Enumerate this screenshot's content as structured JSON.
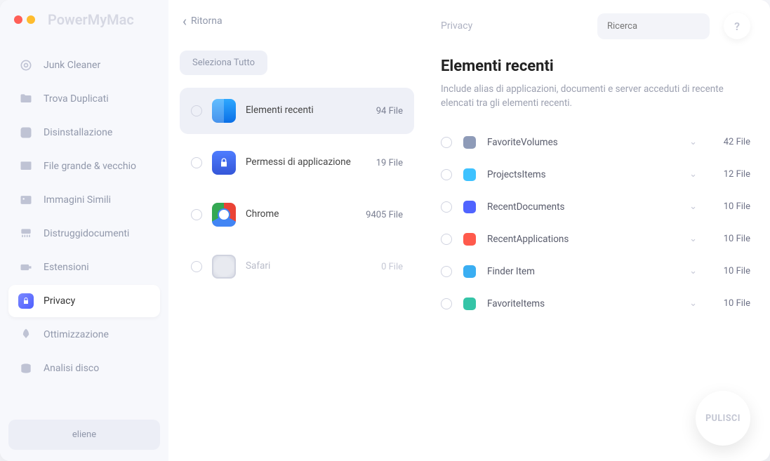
{
  "brand": "PowerMyMac",
  "sidebar": {
    "items": [
      {
        "label": "Junk Cleaner"
      },
      {
        "label": "Trova Duplicati"
      },
      {
        "label": "Disinstallazione"
      },
      {
        "label": "File grande & vecchio"
      },
      {
        "label": "Immagini Simili"
      },
      {
        "label": "Distruggidocumenti"
      },
      {
        "label": "Estensioni"
      },
      {
        "label": "Privacy"
      },
      {
        "label": "Ottimizzazione"
      },
      {
        "label": "Analisi disco"
      }
    ],
    "user": "eliene"
  },
  "middle": {
    "back": "Ritorna",
    "select_all": "Seleziona Tutto",
    "categories": [
      {
        "label": "Elementi recenti",
        "count": "94 File"
      },
      {
        "label": "Permessi di applicazione",
        "count": "19 File"
      },
      {
        "label": "Chrome",
        "count": "9405 File"
      },
      {
        "label": "Safari",
        "count": "0 File"
      }
    ]
  },
  "right": {
    "top_title": "Privacy",
    "search_placeholder": "Ricerca",
    "help": "?",
    "section_title": "Elementi recenti",
    "section_desc": "Include alias di applicazioni, documenti e server acceduti di recente elencati tra gli elementi recenti.",
    "items": [
      {
        "name": "FavoriteVolumes",
        "count": "42 File",
        "color": "#8e9bb8"
      },
      {
        "name": "ProjectsItems",
        "count": "12 File",
        "color": "#3ec2ff"
      },
      {
        "name": "RecentDocuments",
        "count": "10 File",
        "color": "#5064ff"
      },
      {
        "name": "RecentApplications",
        "count": "10 File",
        "color": "#ff5a4c"
      },
      {
        "name": "Finder Item",
        "count": "10 File",
        "color": "#3aaef2"
      },
      {
        "name": "FavoriteItems",
        "count": "10 File",
        "color": "#35c4a7"
      }
    ],
    "clean": "PULISCI"
  }
}
